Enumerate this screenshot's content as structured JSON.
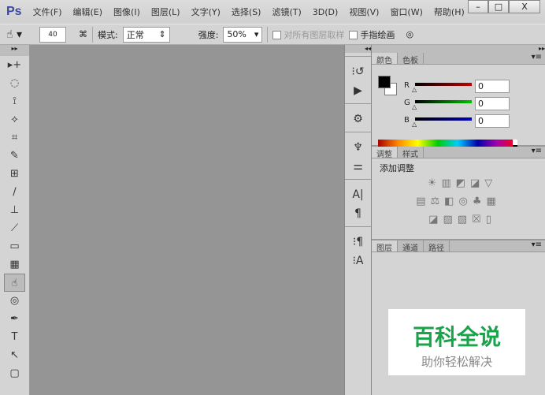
{
  "app": {
    "logo": "Ps",
    "menus": [
      "文件(F)",
      "编辑(E)",
      "图像(I)",
      "图层(L)",
      "文字(Y)",
      "选择(S)",
      "滤镜(T)",
      "3D(D)",
      "视图(V)",
      "窗口(W)",
      "帮助(H)"
    ],
    "window_buttons": [
      "–",
      "□",
      "X"
    ]
  },
  "options": {
    "brush_size": "40",
    "mode_label": "模式:",
    "mode_value": "正常",
    "strength_label": "强度:",
    "strength_value": "50%",
    "sample_all_label": "对所有图层取样",
    "finger_paint_label": "手指绘画"
  },
  "tools": [
    "▸+",
    "◌",
    "⟟",
    "⟡",
    "⌗",
    "✎",
    "⊞",
    "∕",
    "⊥",
    "⟋",
    "▭",
    "▦",
    "☝",
    "◎",
    "✒",
    "T",
    "↖",
    "▢"
  ],
  "dock_icons": [
    "⁝↺",
    "▶",
    "⚙",
    "♆",
    "⚌",
    "A|",
    "¶",
    "⁝¶",
    "⁝A"
  ],
  "color_panel": {
    "tabs": [
      "颜色",
      "色板"
    ],
    "channels": [
      {
        "label": "R",
        "value": "0",
        "color": "#c00000"
      },
      {
        "label": "G",
        "value": "0",
        "color": "#00c000"
      },
      {
        "label": "B",
        "value": "0",
        "color": "#0000c0"
      }
    ]
  },
  "adjust_panel": {
    "tabs": [
      "调整",
      "样式"
    ],
    "title": "添加调整",
    "icons": [
      [
        "☀",
        "▥",
        "◩",
        "◪",
        "▽"
      ],
      [
        "▤",
        "⚖",
        "◧",
        "◎",
        "♣",
        "▦"
      ],
      [
        "◪",
        "▨",
        "▧",
        "☒",
        "▯"
      ]
    ]
  },
  "layers_panel": {
    "tabs": [
      "图层",
      "通道",
      "路径"
    ]
  },
  "watermark": {
    "title": "百科全说",
    "subtitle": "助你轻松解决"
  }
}
